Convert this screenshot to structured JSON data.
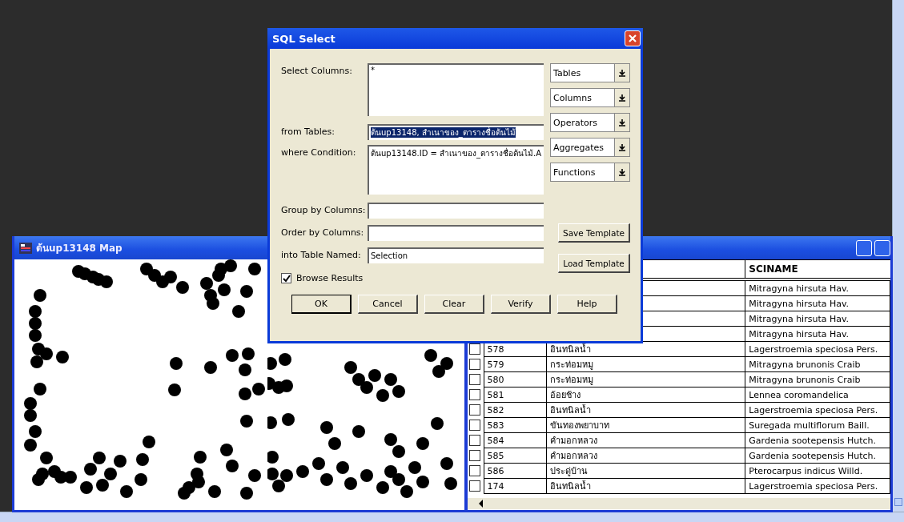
{
  "dialog": {
    "title": "SQL Select",
    "fields": [
      {
        "label": "Select Columns:",
        "value": "*",
        "kind": "area"
      },
      {
        "label": "from Tables:",
        "value": "ต้นup13148, สำเนาของ_ตารางชื่อต้นไม้",
        "kind": "selected-line"
      },
      {
        "label": "where Condition:",
        "value": "ต้นup13148.ID = สำเนาของ_ตารางชื่อต้นไม้.A",
        "kind": "area"
      },
      {
        "label": "Group by Columns:",
        "kind": "line"
      },
      {
        "label": "Order by Columns:",
        "kind": "line"
      },
      {
        "label": "into Table Named:",
        "value": "Selection",
        "kind": "line"
      }
    ],
    "dropdowns": [
      "Tables",
      "Columns",
      "Operators",
      "Aggregates",
      "Functions"
    ],
    "template_buttons": [
      "Save Template",
      "Load Template"
    ],
    "browse_results": {
      "label": "Browse Results",
      "checked": true
    },
    "buttons": [
      "OK",
      "Cancel",
      "Clear",
      "Verify",
      "Help"
    ]
  },
  "map_window": {
    "title": "ต้นup13148 Map"
  },
  "browser": {
    "columns": [
      "SCINAME"
    ],
    "rows": [
      {
        "sciname": "Mitragyna hirsuta Hav."
      },
      {
        "sciname": "Mitragyna hirsuta Hav."
      },
      {
        "sciname": "Mitragyna hirsuta Hav."
      },
      {
        "sciname": "Mitragyna hirsuta Hav."
      },
      {
        "id": "578",
        "name": "อินทนิลน้ำ",
        "sciname": "Lagerstroemia speciosa Pers.",
        "checked": false
      },
      {
        "id": "579",
        "name": "กระท่อมหมู",
        "sciname": "Mitragyna brunonis Craib",
        "checked": false
      },
      {
        "id": "580",
        "name": "กระท่อมหมู",
        "sciname": "Mitragyna brunonis Craib",
        "checked": false
      },
      {
        "id": "581",
        "name": "อ้อยช้าง",
        "sciname": "Lennea coromandelica",
        "checked": false
      },
      {
        "id": "582",
        "name": "อินทนิลน้ำ",
        "sciname": "Lagerstroemia speciosa Pers.",
        "checked": false
      },
      {
        "id": "583",
        "name": "ขันทองพยาบาท",
        "sciname": "Suregada multiflorum Baill.",
        "checked": false
      },
      {
        "id": "584",
        "name": "คำมอกหลวง",
        "sciname": "Gardenia sootepensis Hutch.",
        "checked": false
      },
      {
        "id": "585",
        "name": "คำมอกหลวง",
        "sciname": "Gardenia sootepensis Hutch.",
        "checked": false
      },
      {
        "id": "586",
        "name": "ประดู่บ้าน",
        "sciname": "Pterocarpus indicus Willd.",
        "checked": false
      },
      {
        "id": "174",
        "name": "อินทนิลน้ำ",
        "sciname": "Lagerstroemia speciosa Pers.",
        "checked": false
      }
    ]
  }
}
